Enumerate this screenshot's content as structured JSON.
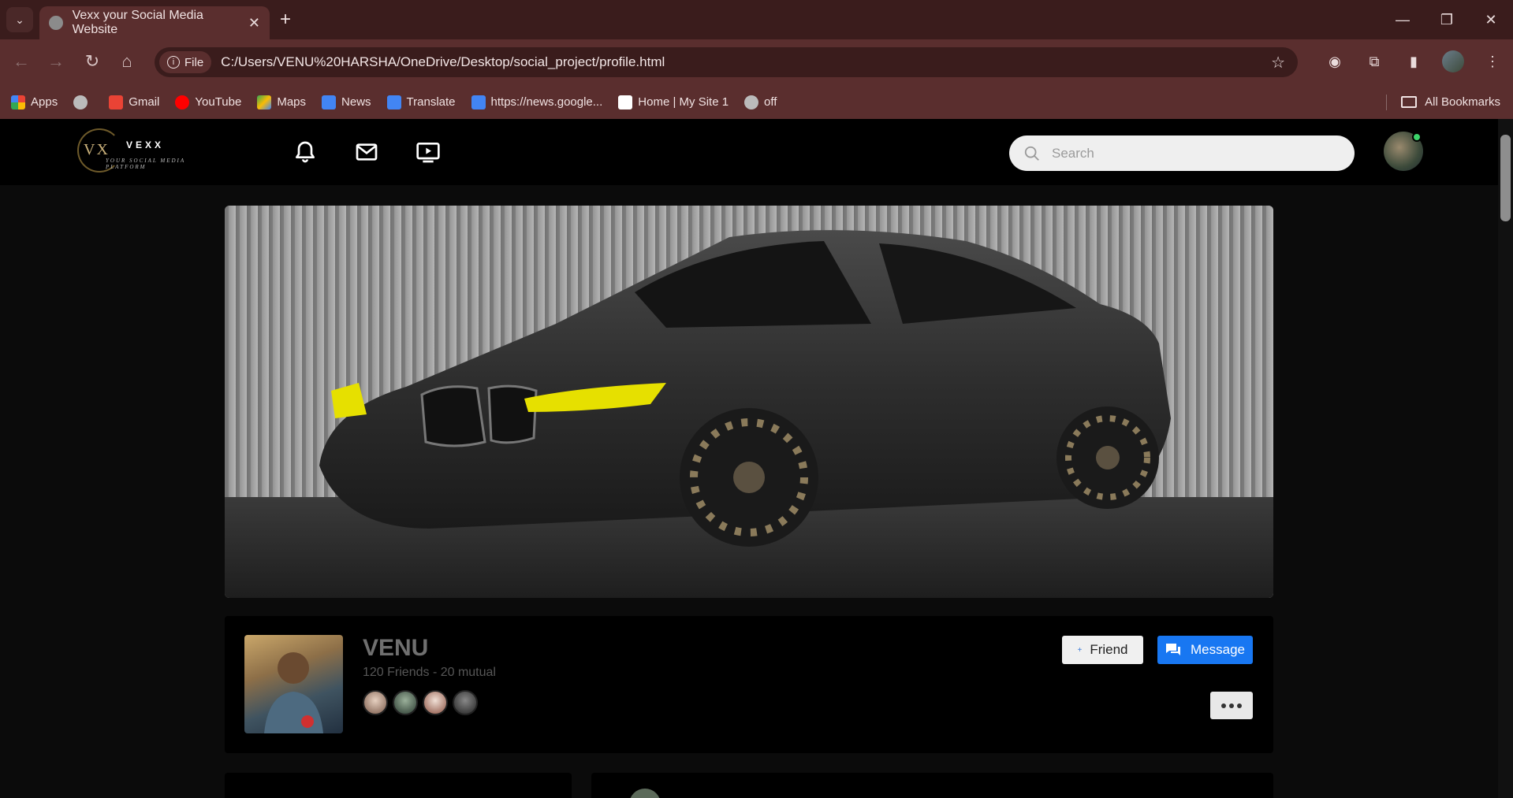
{
  "browser": {
    "tab_title": "Vexx your Social Media Website",
    "url_chip": "File",
    "url": "C:/Users/VENU%20HARSHA/OneDrive/Desktop/social_project/profile.html",
    "bookmarks": [
      "Apps",
      "Gmail",
      "YouTube",
      "Maps",
      "News",
      "Translate",
      "https://news.google...",
      "Home | My Site 1",
      "off"
    ],
    "all_bookmarks": "All Bookmarks"
  },
  "site": {
    "logo_name": "VEXX",
    "logo_tagline": "YOUR SOCIAL MEDIA PLATFORM",
    "logo_mark": "VX",
    "search_placeholder": "Search"
  },
  "profile": {
    "name": "VENU",
    "friends_text": "120 Friends - 20 mutual",
    "friend_button": "Friend",
    "message_button": "Message"
  }
}
